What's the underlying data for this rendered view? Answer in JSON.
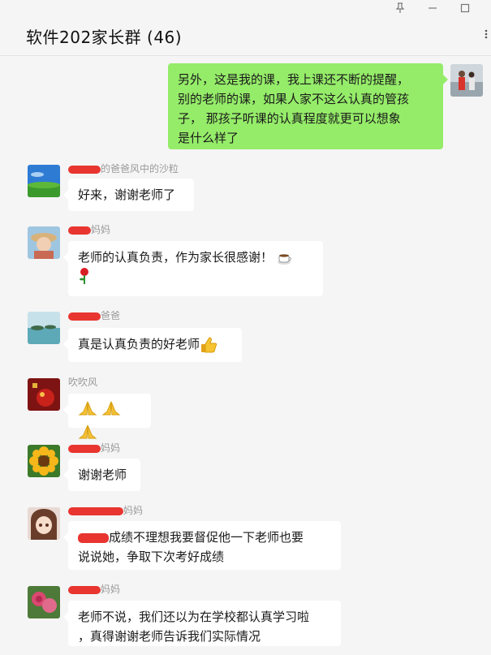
{
  "window": {
    "title": "软件202家长群 (46)",
    "pin_icon": "pin-icon",
    "minimize_icon": "minimize-icon",
    "maximize_icon": "maximize-icon",
    "more_icon": "more-icon"
  },
  "messages": [
    {
      "sender": "me",
      "avatar": "avatar-people-photo",
      "text_lines": [
        "另外，这是我的课，我上课还不断的提醒，",
        "别的老师的课，如果人家不这么认真的管孩",
        "子， 那孩子听课的认真程度就更可以想象",
        "是什么样了"
      ]
    },
    {
      "sender_name": "的爸爸风中的沙粒",
      "avatar": "avatar-landscape",
      "text": "好来，谢谢老师了"
    },
    {
      "sender_name": "妈妈",
      "avatar": "avatar-girl-hat",
      "text": "老师的认真负责，作为家长很感谢！",
      "emojis": [
        "coffee-icon",
        "rose-icon"
      ]
    },
    {
      "sender_name": "爸爸",
      "avatar": "avatar-lake",
      "text": "真是认真负责的好老师",
      "emojis": [
        "thumbs-up-icon"
      ]
    },
    {
      "sender_name": "吹吹风",
      "avatar": "avatar-ornament",
      "emojis": [
        "pray-icon",
        "pray-icon",
        "pray-icon"
      ]
    },
    {
      "sender_name": "妈妈",
      "avatar": "avatar-sunflower",
      "text": "谢谢老师"
    },
    {
      "sender_name": "妈妈",
      "avatar": "avatar-anime-girl",
      "text_lines": [
        "成绩不理想我要督促他一下老师也要",
        "说说她，争取下次考好成绩"
      ]
    },
    {
      "sender_name": "妈妈",
      "avatar": "avatar-rose",
      "text_lines": [
        "老师不说，我们还以为在学校都认真学习啦",
        "，真得谢谢老师告诉我们实际情况"
      ]
    }
  ]
}
